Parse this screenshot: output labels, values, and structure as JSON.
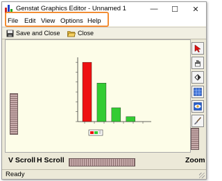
{
  "window": {
    "title": "Genstat Graphics Editor - Unnamed 1",
    "controls": {
      "minimize": "—",
      "maximize": "☐",
      "close": "✕"
    }
  },
  "menu": [
    "File",
    "Edit",
    "View",
    "Options",
    "Help"
  ],
  "toolbar": {
    "save_close_label": "Save and Close",
    "close_label": "Close"
  },
  "tools": [
    "pointer-arrow-icon",
    "hand-icon",
    "fill-icon",
    "grid-icon",
    "eye-icon",
    "brush-icon"
  ],
  "bottom": {
    "vscroll_label": "V Scroll",
    "hscroll_label": "H Scroll",
    "zoom_label": "Zoom"
  },
  "status": "Ready",
  "colors": {
    "accent_highlight": "#f28c33",
    "canvas_bg": "#fdfde8",
    "bar_red": "#ee1111",
    "bar_green": "#33cc33"
  },
  "chart_data": {
    "type": "bar",
    "categories": [
      "",
      "",
      "",
      "",
      "",
      "",
      ""
    ],
    "series": [
      {
        "values": [
          120,
          0,
          0,
          0
        ],
        "color": "#ee1111"
      },
      {
        "values": [
          0,
          78,
          28,
          10
        ],
        "color": "#33cc33"
      }
    ],
    "bars": [
      {
        "value": 120,
        "color": "#ee1111"
      },
      {
        "value": 78,
        "color": "#33cc33"
      },
      {
        "value": 28,
        "color": "#33cc33"
      },
      {
        "value": 10,
        "color": "#33cc33"
      }
    ],
    "ylim": [
      0,
      130
    ],
    "grid": false,
    "legend_position": "bottom-center"
  }
}
